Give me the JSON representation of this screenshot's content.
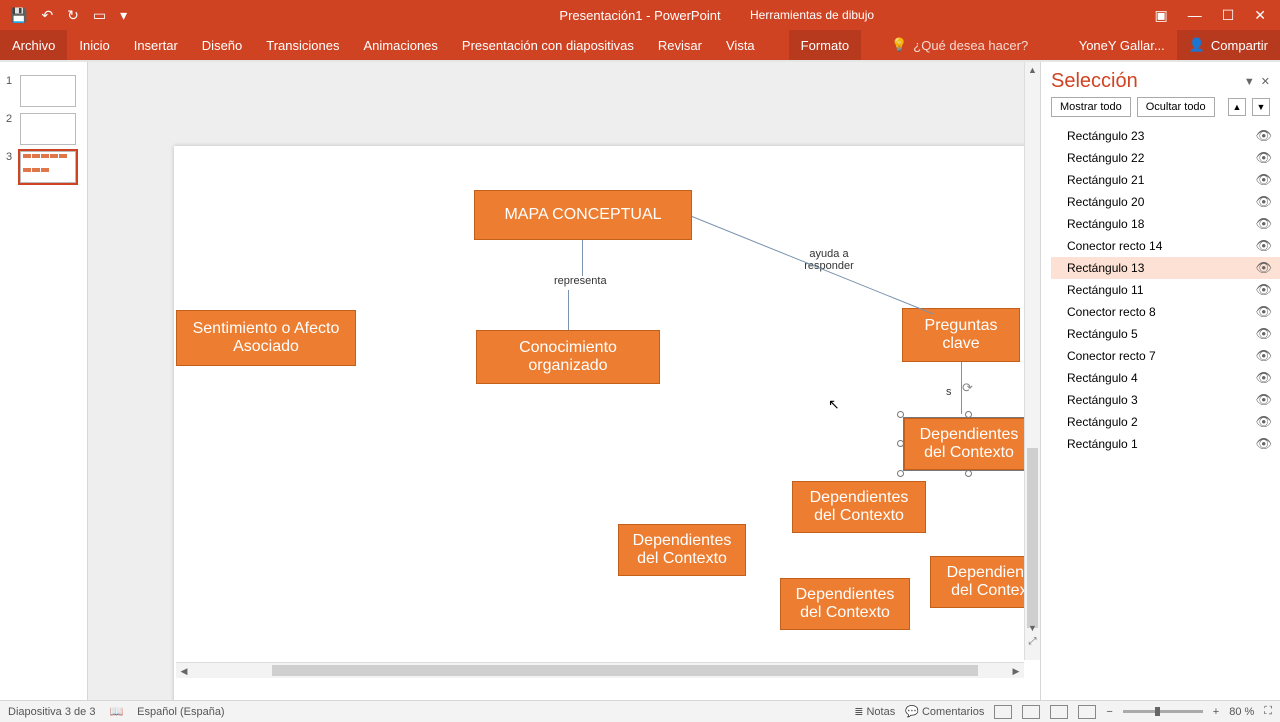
{
  "title": "Presentación1 - PowerPoint",
  "tools_tab": "Herramientas de dibujo",
  "tabs": {
    "file": "Archivo",
    "home": "Inicio",
    "insert": "Insertar",
    "design": "Diseño",
    "transitions": "Transiciones",
    "animations": "Animaciones",
    "slideshow": "Presentación con diapositivas",
    "review": "Revisar",
    "view": "Vista",
    "format": "Formato"
  },
  "tell_me": "¿Qué desea hacer?",
  "user": "YoneY Gallar...",
  "share": "Compartir",
  "thumbs": [
    "1",
    "2",
    "3"
  ],
  "shapes": {
    "title": "MAPA CONCEPTUAL",
    "s1": "Sentimiento o Afecto Asociado",
    "s2": "Conocimiento organizado",
    "s3": "Preguntas clave",
    "s4": "Dependientes del Contexto",
    "s5": "Dependientes del Contexto",
    "s6": "Dependientes del Contexto",
    "s7": "Dependientes del Contexto",
    "s8": "Dependientes del Contexto"
  },
  "labels": {
    "l1": "representa",
    "l2": "ayuda a responder",
    "l3": "s"
  },
  "selection_pane": {
    "title": "Selección",
    "show_all": "Mostrar todo",
    "hide_all": "Ocultar todo",
    "items": [
      "Rectángulo 23",
      "Rectángulo 22",
      "Rectángulo 21",
      "Rectángulo 20",
      "Rectángulo 18",
      "Conector recto 14",
      "Rectángulo 13",
      "Rectángulo 11",
      "Conector recto 8",
      "Rectángulo 5",
      "Conector recto 7",
      "Rectángulo 4",
      "Rectángulo 3",
      "Rectángulo 2",
      "Rectángulo 1"
    ],
    "selected_index": 6
  },
  "status": {
    "slide_of": "Diapositiva 3 de 3",
    "lang": "Español (España)",
    "notes": "Notas",
    "comments": "Comentarios",
    "zoom": "80 %"
  }
}
